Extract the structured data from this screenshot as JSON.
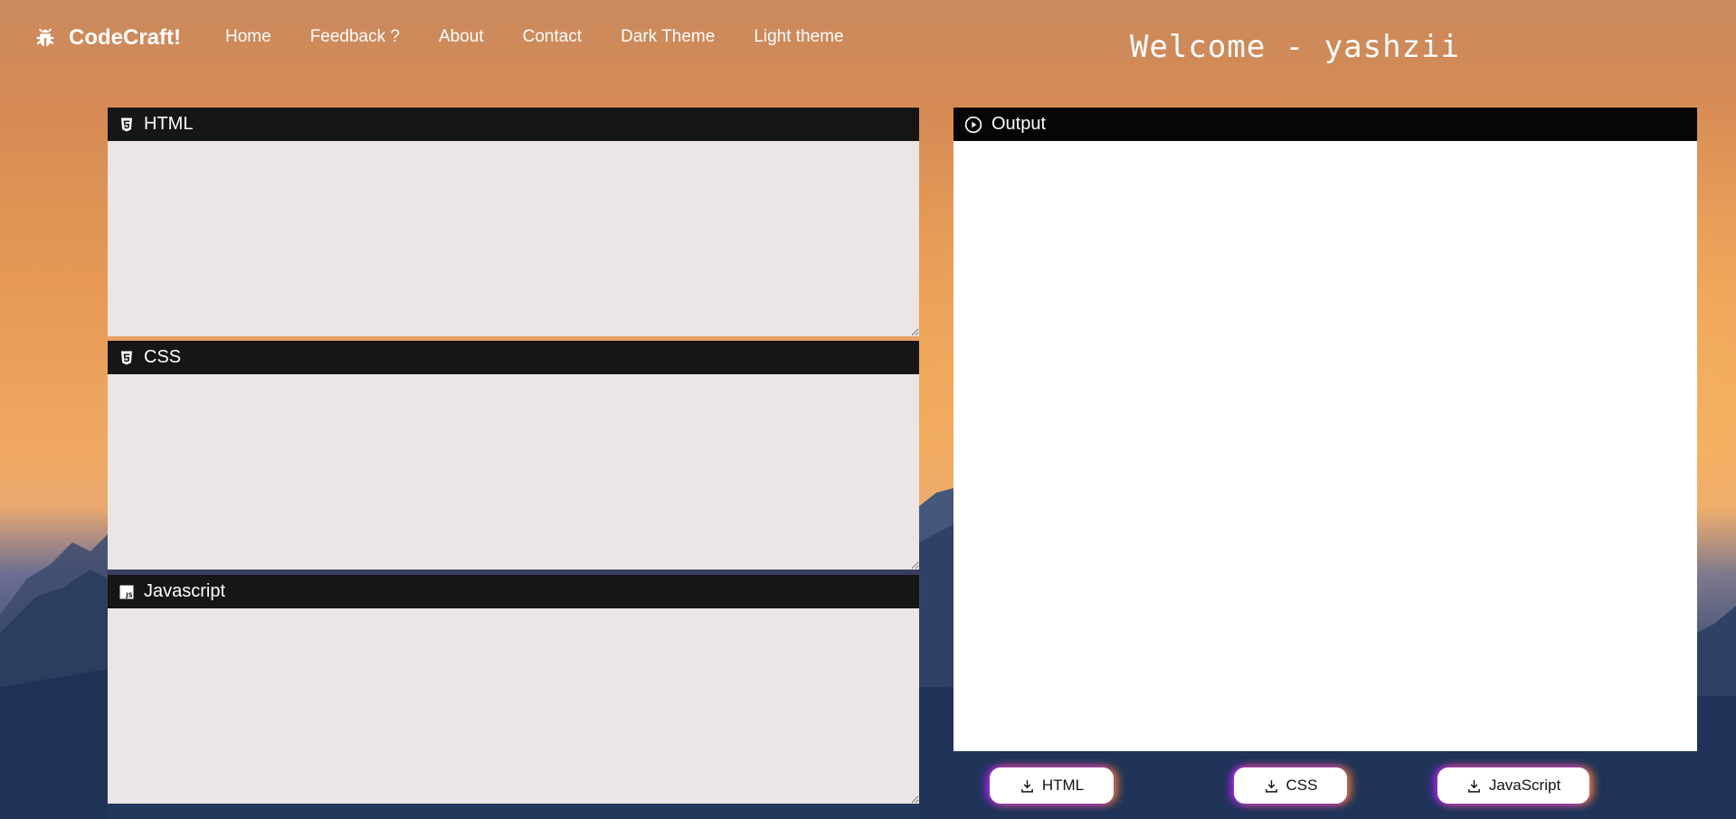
{
  "navbar": {
    "brand": "CodeCraft!",
    "brand_icon": "bug-icon",
    "links": [
      "Home",
      "Feedback ?",
      "About",
      "Contact",
      "Dark Theme",
      "Light theme"
    ],
    "welcome": "Welcome - yashzii"
  },
  "editors": {
    "html": {
      "title": "HTML",
      "icon": "html5-icon",
      "value": ""
    },
    "css": {
      "title": "CSS",
      "icon": "css3-icon",
      "value": ""
    },
    "js": {
      "title": "Javascript",
      "icon": "js-icon",
      "value": ""
    }
  },
  "output": {
    "title": "Output",
    "icon": "play-circle-icon"
  },
  "downloads": {
    "html": "HTML",
    "css": "CSS",
    "js": "JavaScript",
    "icon": "download-icon"
  },
  "colors": {
    "panel_header": "#161616",
    "editor_bg": "#ebe5e5",
    "output_bg": "#ffffff",
    "text": "#ffffff"
  }
}
